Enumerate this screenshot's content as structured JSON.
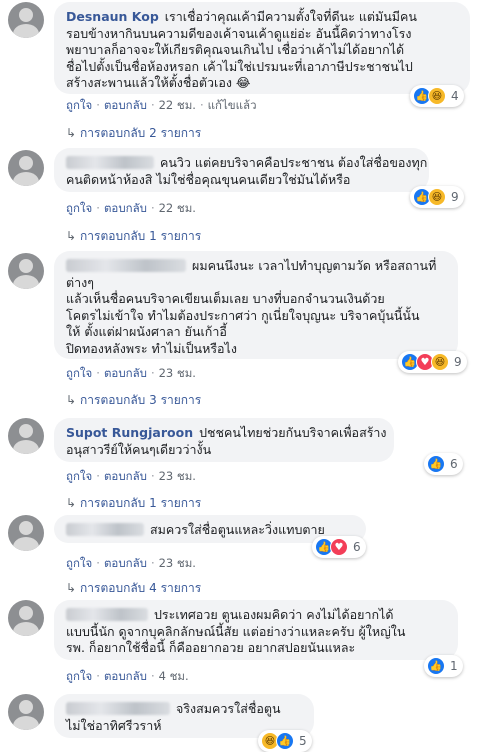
{
  "comments": [
    {
      "name": "Desnaun Kop",
      "lines": [
        "เราเชื่อว่าคุณเค้ามีความตั้งใจที่ดีนะ แต่มันมีคน",
        "รอบข้างหากินบนความดีของเค้าจนเค้าดูแย่อ่ะ อันนี้คิดว่าทางโรง",
        "พยาบาลก็อาจจะให้เกียรติคุณจนเกินไป เชื่อว่าเค้าไม่ได้อยากได้",
        "ชื่อไปตั้งเป็นชื่อห้องหรอก เค้าไม่ใช่เปรมนะที่เอาภาษีประชาชนไป",
        "สร้างสะพานแล้วให้ตั้งชื่อตัวเอง 😂"
      ],
      "reactions": [
        "like",
        "haha"
      ],
      "count": "4",
      "actions": [
        "ถูกใจ",
        "ตอบกลับ",
        "22 ชม.",
        "แก้ไขแล้ว"
      ],
      "replies": "การตอบกลับ 2 รายการ"
    },
    {
      "name": "",
      "lines": [
        "คนวิว แต่คยบริจาคคือประชาชน ต้องใส่ชื่อของทุก",
        "คนติดหน้าห้องสิ ไม่ใช่ชื่อคุณขุนคนเดียวใช่มันได้หรือ"
      ],
      "reactions": [
        "like",
        "haha"
      ],
      "count": "9",
      "actions": [
        "ถูกใจ",
        "ตอบกลับ",
        "22 ชม."
      ],
      "replies": "การตอบกลับ 1 รายการ"
    },
    {
      "name": "",
      "lines": [
        "ผมคนนึงนะ เวลาไปทำบุญตามวัด หรือสถานที่",
        "ต่างๆ",
        "แล้วเห็นชื่อคนบริจาคเขียนเต็มเลย บางที่บอกจำนวนเงินด้วย",
        "โคตรไม่เข้าใจ ทำไมต้องประกาศว่า กูเนี่ยใจบุญนะ บริจาคบุ้นนี้นั้น",
        "ให้ ตั้งแต่ฝาผนังศาลา ยันเก้าอี้",
        "ปิดทองหลังพระ ทำไม่เป็นหรือไง"
      ],
      "reactions": [
        "like",
        "love",
        "haha"
      ],
      "count": "9",
      "actions": [
        "ถูกใจ",
        "ตอบกลับ",
        "23 ชม."
      ],
      "replies": "การตอบกลับ 3 รายการ"
    },
    {
      "name": "Supot Rungjaroon",
      "lines": [
        "ปชชคนไทยช่วยกันบริจาคเพื่อสร้าง",
        "อนุสาวรีย์ให้คนๆเดียวว่างั้น"
      ],
      "reactions": [
        "like"
      ],
      "count": "6",
      "actions": [
        "ถูกใจ",
        "ตอบกลับ",
        "23 ชม."
      ],
      "replies": "การตอบกลับ 1 รายการ"
    },
    {
      "name": "",
      "lines": [
        "สมควรใส่ชื่อตูนแหละวิ่งแทบตาย"
      ],
      "reactions": [
        "like",
        "love"
      ],
      "count": "6",
      "actions": [
        "ถูกใจ",
        "ตอบกลับ",
        "23 ชม."
      ],
      "replies": "การตอบกลับ 4 รายการ"
    },
    {
      "name": "",
      "lines": [
        "ประเทศอวย ตูนเองผมคิดว่า คงไม่ได้อยากได้",
        "แบบนี้นัก ดูจากบุคลิกลักษณ์นี้สัย แต่อย่างว่าแหละครับ ผู้ใหญ่ใน",
        "รพ. ก็อยากใช้ชื่อนี้ ก็คืออยากอวย อยากสปอยนันแหละ"
      ],
      "reactions": [
        "like"
      ],
      "count": "1",
      "actions": [
        "ถูกใจ",
        "ตอบกลับ",
        "4 ชม."
      ],
      "replies": ""
    },
    {
      "name": "",
      "lines": [
        "จริงสมควรใส่ชื่อตูน",
        "ไม่ใช่อาทิศรีวราห์"
      ],
      "reactions": [
        "haha",
        "like"
      ],
      "count": "5",
      "actions": [],
      "replies": ""
    }
  ]
}
